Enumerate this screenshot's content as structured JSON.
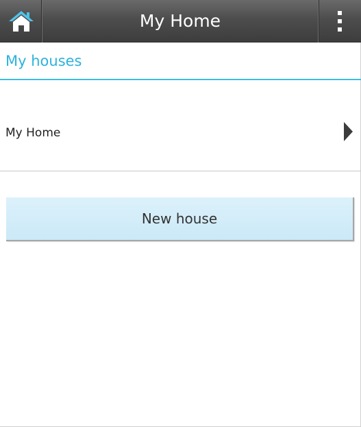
{
  "header": {
    "title": "My Home",
    "home_icon": "home-icon",
    "menu_icon": "overflow-menu-icon"
  },
  "section": {
    "title": "My houses"
  },
  "houses": [
    {
      "label": "My Home",
      "icon": "chevron-right-icon"
    }
  ],
  "actions": {
    "new_house_label": "New house"
  },
  "colors": {
    "accent": "#2cb3dc",
    "toolbar": "#4d4d4d",
    "button_bg": "#d4edf9"
  }
}
